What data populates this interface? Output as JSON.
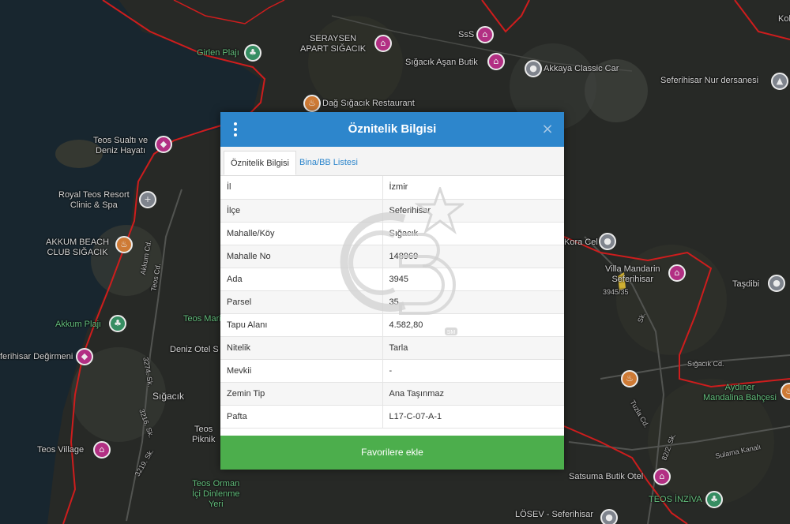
{
  "map": {
    "labels": [
      {
        "id": "seraysen",
        "text": "SERAYSEN\nAPART SIĞACIK"
      },
      {
        "id": "sss",
        "text": "SsS"
      },
      {
        "id": "girlen",
        "text": "Girlen Plajı"
      },
      {
        "id": "asan",
        "text": "Sığacık Aşan Butik"
      },
      {
        "id": "akkaya",
        "text": "Akkaya Classic Car"
      },
      {
        "id": "nur",
        "text": "Seferihisar Nur dersanesi"
      },
      {
        "id": "dag",
        "text": "Dağ Sığacık Restaurant"
      },
      {
        "id": "teos-sualti",
        "text": "Teos Sualtı ve\nDeniz Hayatı"
      },
      {
        "id": "royal",
        "text": "Royal Teos Resort\nClinic & Spa"
      },
      {
        "id": "akkum-beach",
        "text": "AKKUM BEACH\nCLUB SIĞACIK"
      },
      {
        "id": "akkum-plaji",
        "text": "Akkum Plajı"
      },
      {
        "id": "teos-mar",
        "text": "Teos Mari"
      },
      {
        "id": "deniz-otel",
        "text": "Deniz Otel S"
      },
      {
        "id": "degirmen",
        "text": "ferihisar Değirmeni"
      },
      {
        "id": "sigacik",
        "text": "Sığacık"
      },
      {
        "id": "teos-village",
        "text": "Teos Village"
      },
      {
        "id": "teos-orman",
        "text": "Teos Orman\nİçi Dinlenme\nYeri"
      },
      {
        "id": "teos-pik",
        "text": "Teos\nPiknik"
      },
      {
        "id": "kora",
        "text": "Kora Cel"
      },
      {
        "id": "villa",
        "text": "Villa Mandarin\nSeferihisar"
      },
      {
        "id": "tasdibi",
        "text": "Taşdibi"
      },
      {
        "id": "parcel",
        "text": "3945/35"
      },
      {
        "id": "sigacik-cd",
        "text": "Sığacık Cd."
      },
      {
        "id": "aydiner",
        "text": "Aydıner\nMandalina Bahçesi"
      },
      {
        "id": "satsuma",
        "text": "Satsuma Butik Otel"
      },
      {
        "id": "teos-inziva",
        "text": "TEOS İNZİVA"
      },
      {
        "id": "losev",
        "text": "LÖSEV - Seferihisar"
      },
      {
        "id": "sulama",
        "text": "Sulama Kanalı"
      },
      {
        "id": "kol",
        "text": "Kol"
      },
      {
        "id": "akkum-cd",
        "text": "Akkum Cd."
      },
      {
        "id": "teos-cd",
        "text": "Teos Cd."
      },
      {
        "id": "sk3274",
        "text": "3274. Sk."
      },
      {
        "id": "sk3219",
        "text": "3219. Sk."
      },
      {
        "id": "sk3216",
        "text": "3216. Sk."
      },
      {
        "id": "tuzla",
        "text": "Tuzla Cd."
      },
      {
        "id": "sk822",
        "text": "82/2. Sk."
      },
      {
        "id": "sk-2",
        "text": "Sk."
      }
    ]
  },
  "modal": {
    "title": "Öznitelik Bilgisi",
    "close_label": "×",
    "tabs": [
      {
        "label": "Öznitelik Bilgisi",
        "active": true
      },
      {
        "label": "Bina/BB Listesi",
        "active": false
      }
    ],
    "rows": [
      {
        "key": "İl",
        "value": "İzmir"
      },
      {
        "key": "İlçe",
        "value": "Seferihisar"
      },
      {
        "key": "Mahalle/Köy",
        "value": "Sığacık"
      },
      {
        "key": "Mahalle No",
        "value": "148969"
      },
      {
        "key": "Ada",
        "value": "3945"
      },
      {
        "key": "Parsel",
        "value": "35"
      },
      {
        "key": "Tapu Alanı",
        "value": "4.582,80"
      },
      {
        "key": "Nitelik",
        "value": "Tarla"
      },
      {
        "key": "Mevkii",
        "value": "-"
      },
      {
        "key": "Zemin Tip",
        "value": "Ana Taşınmaz"
      },
      {
        "key": "Pafta",
        "value": "L17-C-07-A-1"
      }
    ],
    "favorite_button": "Favorilere ekle",
    "watermark_text": "SM"
  },
  "colors": {
    "header": "#2d86cc",
    "button": "#4cae4c",
    "boundary": "#e02020",
    "sea": "#1b2a33"
  }
}
